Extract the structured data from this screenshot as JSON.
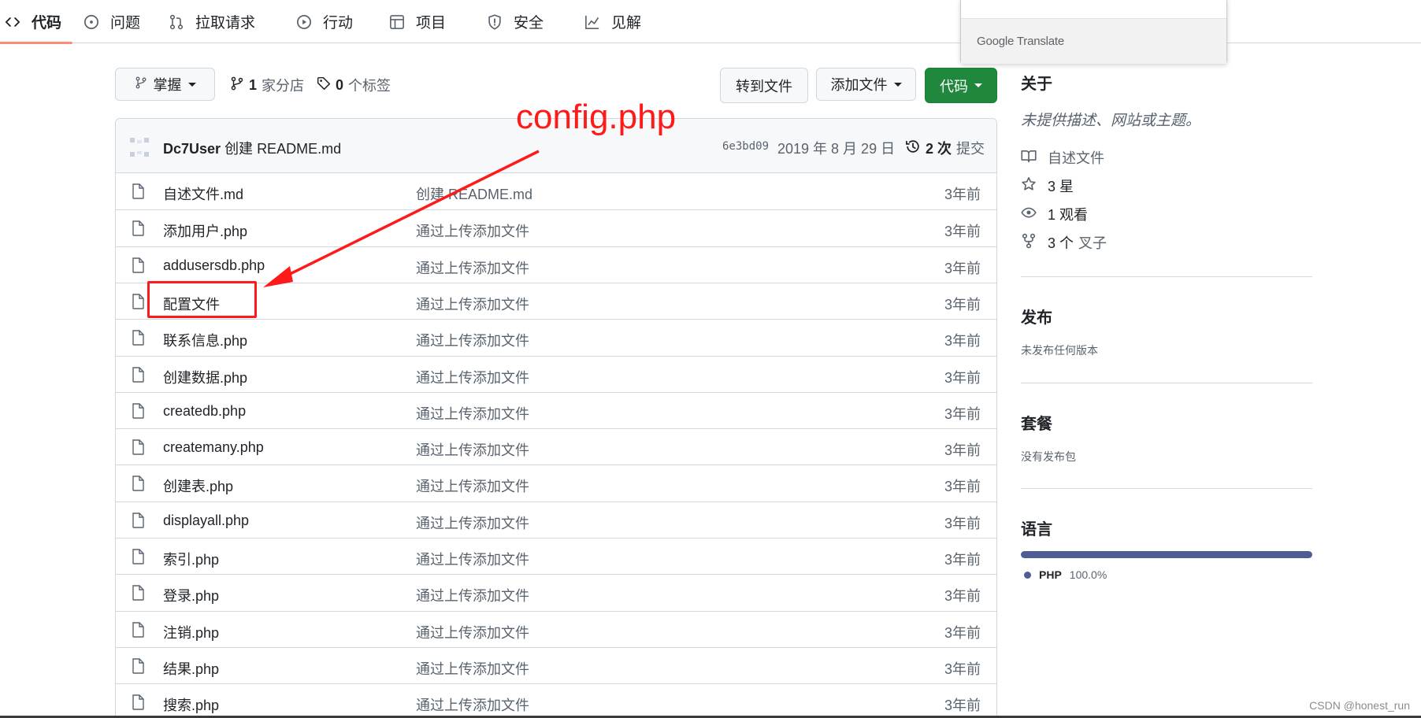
{
  "nav": {
    "tabs": [
      {
        "label": "代码",
        "icon": "code-icon",
        "active": true
      },
      {
        "label": "问题",
        "icon": "issue-icon"
      },
      {
        "label": "拉取请求",
        "icon": "pull-request-icon"
      },
      {
        "label": "行动",
        "icon": "actions-play-icon"
      },
      {
        "label": "项目",
        "icon": "table-icon"
      },
      {
        "label": "安全",
        "icon": "shield-icon"
      },
      {
        "label": "见解",
        "icon": "graph-icon"
      }
    ]
  },
  "translate_popup": {
    "brand": "Google Translate"
  },
  "branch_bar": {
    "branch_label": "掌握",
    "branches_count": "1",
    "branches_label": "家分店",
    "tags_count": "0",
    "tags_label": "个标签",
    "goto_file": "转到文件",
    "add_file": "添加文件",
    "code": "代码"
  },
  "commit": {
    "user": "Dc7User",
    "message": "创建 README.md",
    "sha": "6e3bd09",
    "date": "2019 年 8 月 29 日",
    "count": "2 次",
    "count_label": "提交"
  },
  "files": [
    {
      "name": "自述文件.md",
      "message": "创建 README.md",
      "age": "3年前"
    },
    {
      "name": "添加用户.php",
      "message": "通过上传添加文件",
      "age": "3年前"
    },
    {
      "name": "addusersdb.php",
      "message": "通过上传添加文件",
      "age": "3年前"
    },
    {
      "name": "配置文件",
      "message": "通过上传添加文件",
      "age": "3年前"
    },
    {
      "name": "联系信息.php",
      "message": "通过上传添加文件",
      "age": "3年前"
    },
    {
      "name": "创建数据.php",
      "message": "通过上传添加文件",
      "age": "3年前"
    },
    {
      "name": "createdb.php",
      "message": "通过上传添加文件",
      "age": "3年前"
    },
    {
      "name": "createmany.php",
      "message": "通过上传添加文件",
      "age": "3年前"
    },
    {
      "name": "创建表.php",
      "message": "通过上传添加文件",
      "age": "3年前"
    },
    {
      "name": "displayall.php",
      "message": "通过上传添加文件",
      "age": "3年前"
    },
    {
      "name": "索引.php",
      "message": "通过上传添加文件",
      "age": "3年前"
    },
    {
      "name": "登录.php",
      "message": "通过上传添加文件",
      "age": "3年前"
    },
    {
      "name": "注销.php",
      "message": "通过上传添加文件",
      "age": "3年前"
    },
    {
      "name": "结果.php",
      "message": "通过上传添加文件",
      "age": "3年前"
    },
    {
      "name": "搜索.php",
      "message": "通过上传添加文件",
      "age": "3年前"
    }
  ],
  "annotation": {
    "label": "config.php",
    "color": "#ff1a1a"
  },
  "sidebar": {
    "about_title": "关于",
    "about_desc": "未提供描述、网站或主题。",
    "readme": "自述文件",
    "stars": "3 星",
    "watching": "1 观看",
    "forks_count": "3 个",
    "forks_label": "叉子",
    "releases_title": "发布",
    "releases_desc": "未发布任何版本",
    "packages_title": "套餐",
    "packages_desc": "没有发布包",
    "languages_title": "语言",
    "languages": [
      {
        "name": "PHP",
        "percent": "100.0%",
        "color": "#4f5d95"
      }
    ]
  },
  "watermark": "CSDN @honest_run"
}
